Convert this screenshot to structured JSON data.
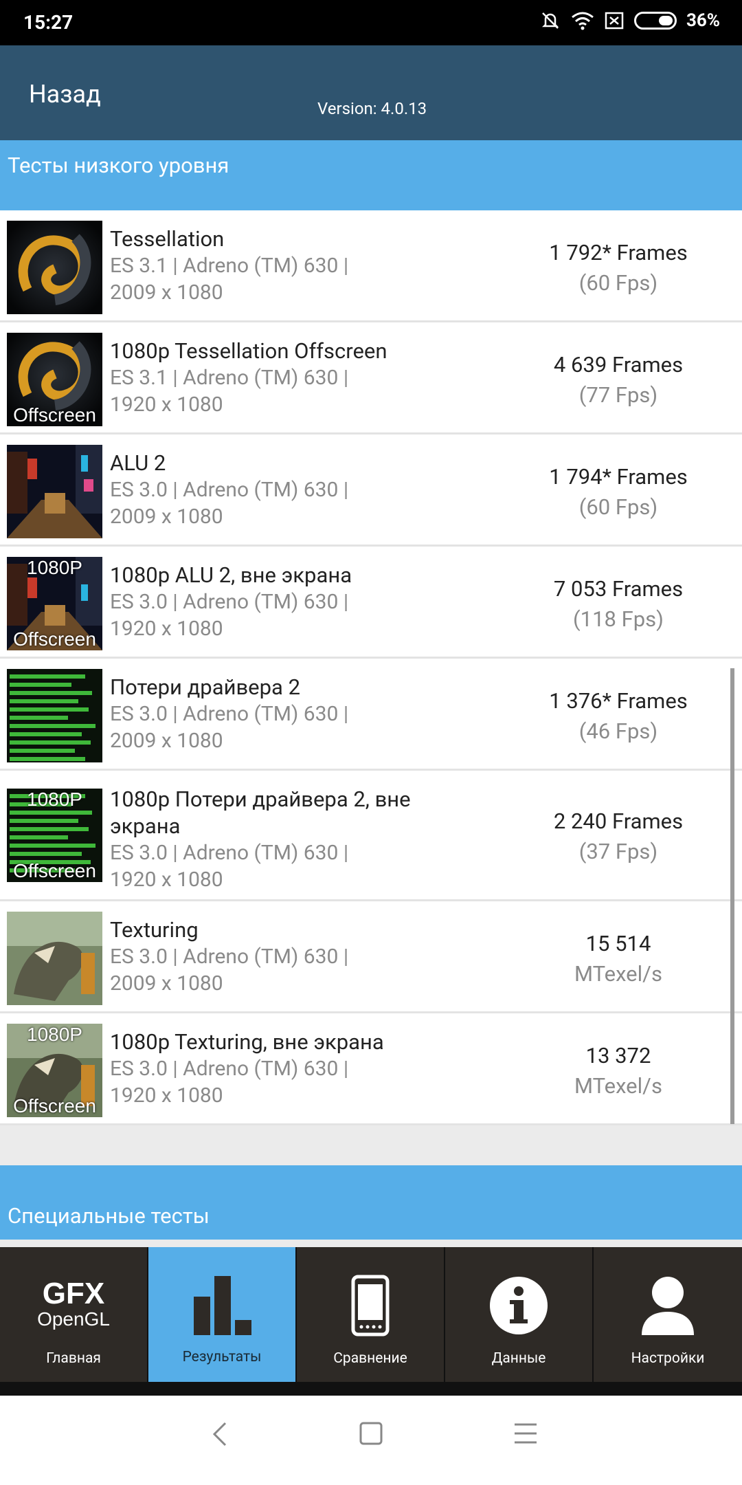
{
  "status_bar": {
    "time": "15:27",
    "battery_percent": "36%"
  },
  "header": {
    "back_label": "Назад",
    "version": "Version: 4.0.13"
  },
  "sections": {
    "low_level": "Тесты низкого уровня",
    "special": "Специальные тесты"
  },
  "tests": [
    {
      "name": "Tessellation",
      "api": "ES 3.1 | Adreno (TM) 630 |",
      "resolution": "2009 x 1080",
      "result": "1 792* Frames",
      "sub": "(60 Fps)"
    },
    {
      "name": "1080p Tessellation Offscreen",
      "api": "ES 3.1 | Adreno (TM) 630 |",
      "resolution": "1920 x 1080",
      "result": "4 639 Frames",
      "sub": "(77 Fps)",
      "thumb_bottom": "Offscreen"
    },
    {
      "name": "ALU 2",
      "api": "ES 3.0 | Adreno (TM) 630 |",
      "resolution": "2009 x 1080",
      "result": "1 794* Frames",
      "sub": "(60 Fps)"
    },
    {
      "name": "1080p ALU 2, вне экрана",
      "api": "ES 3.0 | Adreno (TM) 630 |",
      "resolution": "1920 x 1080",
      "result": "7 053 Frames",
      "sub": "(118 Fps)",
      "thumb_top": "1080P",
      "thumb_bottom": "Offscreen"
    },
    {
      "name": "Потери драйвера 2",
      "api": "ES 3.0 | Adreno (TM) 630 |",
      "resolution": "2009 x 1080",
      "result": "1 376* Frames",
      "sub": "(46 Fps)"
    },
    {
      "name": "1080p Потери драйвера 2, вне экрана",
      "api": "ES 3.0 | Adreno (TM) 630 |",
      "resolution": "1920 x 1080",
      "result": "2 240 Frames",
      "sub": "(37 Fps)",
      "thumb_top": "1080P",
      "thumb_bottom": "Offscreen"
    },
    {
      "name": "Texturing",
      "api": "ES 3.0 | Adreno (TM) 630 |",
      "resolution": "2009 x 1080",
      "result": "15 514",
      "sub": "MTexel/s"
    },
    {
      "name": "1080p Texturing, вне экрана",
      "api": "ES 3.0 | Adreno (TM) 630 |",
      "resolution": "1920 x 1080",
      "result": "13 372",
      "sub": "MTexel/s",
      "thumb_top": "1080P",
      "thumb_bottom": "Offscreen"
    }
  ],
  "tabs": [
    {
      "label": "Главная",
      "logo_top": "GFX",
      "logo_bottom": "OpenGL",
      "icon": "gfx-logo-icon"
    },
    {
      "label": "Результаты",
      "icon": "bar-chart-icon",
      "active": true
    },
    {
      "label": "Сравнение",
      "icon": "phone-icon"
    },
    {
      "label": "Данные",
      "icon": "info-icon"
    },
    {
      "label": "Настройки",
      "icon": "user-icon"
    }
  ],
  "colors": {
    "header": "#2f546f",
    "accent": "#56aee8",
    "tab_bg": "#2e2a26"
  }
}
